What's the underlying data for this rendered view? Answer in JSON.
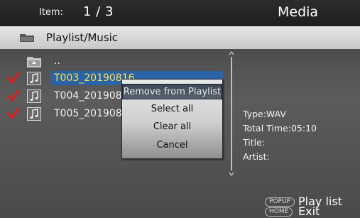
{
  "header": {
    "item_label": "Item:",
    "item_count": "1 / 3",
    "title": "Media"
  },
  "path": {
    "icon": "folder-icon",
    "text": "Playlist/Music"
  },
  "file_list": {
    "parent": {
      "label": "..",
      "icon": "folder-up-icon"
    },
    "items": [
      {
        "name": "T003_20190816",
        "checked": true,
        "selected": true,
        "icon": "music-file-icon"
      },
      {
        "name": "T004_201908",
        "checked": true,
        "selected": false,
        "icon": "music-file-icon"
      },
      {
        "name": "T005_201908",
        "checked": true,
        "selected": false,
        "icon": "music-file-icon"
      }
    ]
  },
  "info": {
    "type": "Type:WAV",
    "total_time": "Total Time:05:10",
    "title": "Title:",
    "artist": "Artist:"
  },
  "popup_menu": {
    "items": [
      {
        "label": "Remove from Playlist",
        "active": true
      },
      {
        "label": "Select all",
        "active": false
      },
      {
        "label": "Clear all",
        "active": false
      },
      {
        "label": "Cancel",
        "active": false
      }
    ]
  },
  "hints": [
    {
      "key": "POPUP",
      "text": "Play list"
    },
    {
      "key": "HOME",
      "text": "Exit"
    }
  ],
  "colors": {
    "selection": "#2a63a8",
    "selected_text": "#ffe24a",
    "checkmark": "#e01b1b"
  }
}
